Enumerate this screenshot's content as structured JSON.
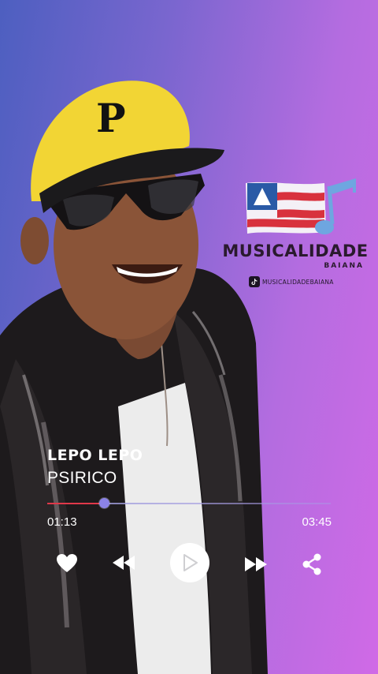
{
  "brand": {
    "title": "MUSICALIDADE",
    "subtitle": "BAIANA",
    "social_handle": "MUSICALIDADEBAIANA",
    "social_icon": "tiktok-icon"
  },
  "track": {
    "title": "LEPO LEPO",
    "artist": "PSIRICO"
  },
  "player": {
    "elapsed": "01:13",
    "duration": "03:45",
    "progress": 0.2,
    "icons": [
      "heart-icon",
      "rewind-icon",
      "play-icon",
      "fast-forward-icon",
      "share-icon"
    ]
  },
  "colors": {
    "background_start": "#4d5fc0",
    "background_end": "#d06ae6",
    "progress_fill": "#e0384a",
    "progress_thumb": "#8b82e6",
    "text": "#ffffff",
    "brand_text": "#2a1a2e"
  }
}
